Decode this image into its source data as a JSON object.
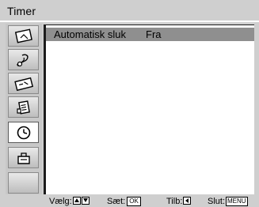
{
  "window": {
    "title": "Timer"
  },
  "sidebar": {
    "items": [
      {
        "icon": "picture-icon",
        "active": false
      },
      {
        "icon": "sound-icon",
        "active": false
      },
      {
        "icon": "screen-control-icon",
        "active": false
      },
      {
        "icon": "features-icon",
        "active": false
      },
      {
        "icon": "clock-icon",
        "active": true
      },
      {
        "icon": "setup-icon",
        "active": false
      },
      {
        "icon": "empty",
        "active": false
      }
    ]
  },
  "menu": {
    "rows": [
      {
        "label": "Automatisk sluk",
        "value": "Fra",
        "selected": true
      }
    ]
  },
  "footer": {
    "select_label": "Vælg:",
    "set_label": "Sæt:",
    "set_key": "OK",
    "back_label": "Tilb:",
    "exit_label": "Slut:",
    "exit_key": "MENU"
  }
}
